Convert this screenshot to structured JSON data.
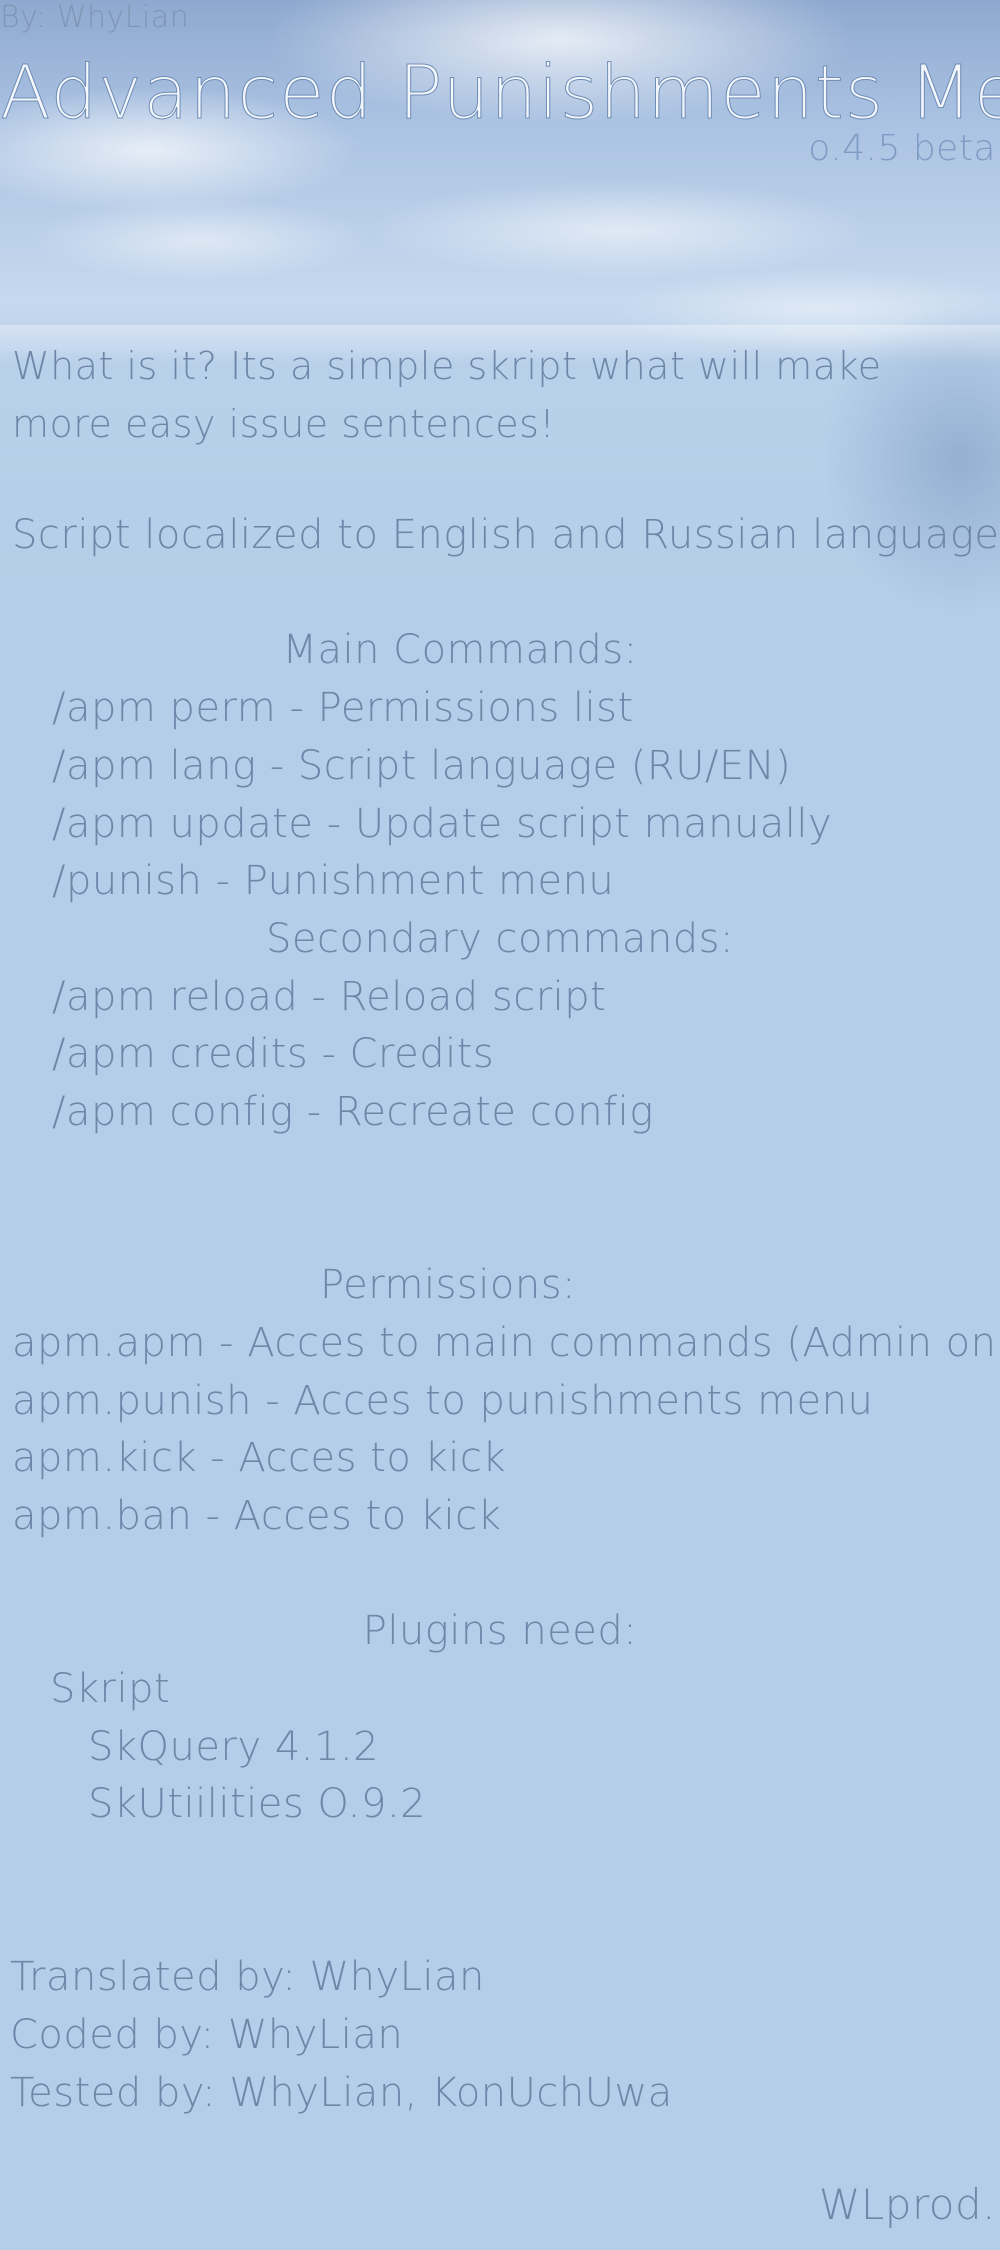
{
  "header": {
    "byline": "By: WhyLian",
    "title": "Advanced Punishments Menu",
    "version": "o.4.5 beta"
  },
  "intro": {
    "description": "What is it? Its a simple skript what will make more easy issue sentences!",
    "localization": "Script localized to English and Russian language!"
  },
  "main_commands": {
    "heading": "Main Commands:",
    "items": [
      "/apm perm - Permissions list",
      "/apm lang - Script language (RU/EN)",
      "/apm update - Update script manually",
      "/punish - Punishment menu"
    ]
  },
  "secondary_commands": {
    "heading": "Secondary commands:",
    "items": [
      "/apm reload - Reload script",
      "/apm credits - Credits",
      "/apm config - Recreate config"
    ]
  },
  "permissions": {
    "heading": "Permissions:",
    "items": [
      "apm.apm - Acces to main commands (Admin only)",
      "apm.punish - Acces to punishments menu",
      "apm.kick - Acces to kick",
      "apm.ban - Acces to kick"
    ]
  },
  "plugins": {
    "heading": "Plugins need:",
    "root": "Skript",
    "addons": [
      "SkQuery 4.1.2",
      "SkUtiilities O.9.2"
    ]
  },
  "credits": {
    "translated": "Translated by: WhyLian",
    "coded": "Coded by: WhyLian",
    "tested": "Tested by: WhyLian, KonUchUwa"
  },
  "footer": {
    "brand": "WLprod."
  },
  "colors": {
    "background": "#b4cde8",
    "text": "#6e86a8",
    "title_fill": "#f3f7fc",
    "title_outline": "#6f8db5"
  }
}
